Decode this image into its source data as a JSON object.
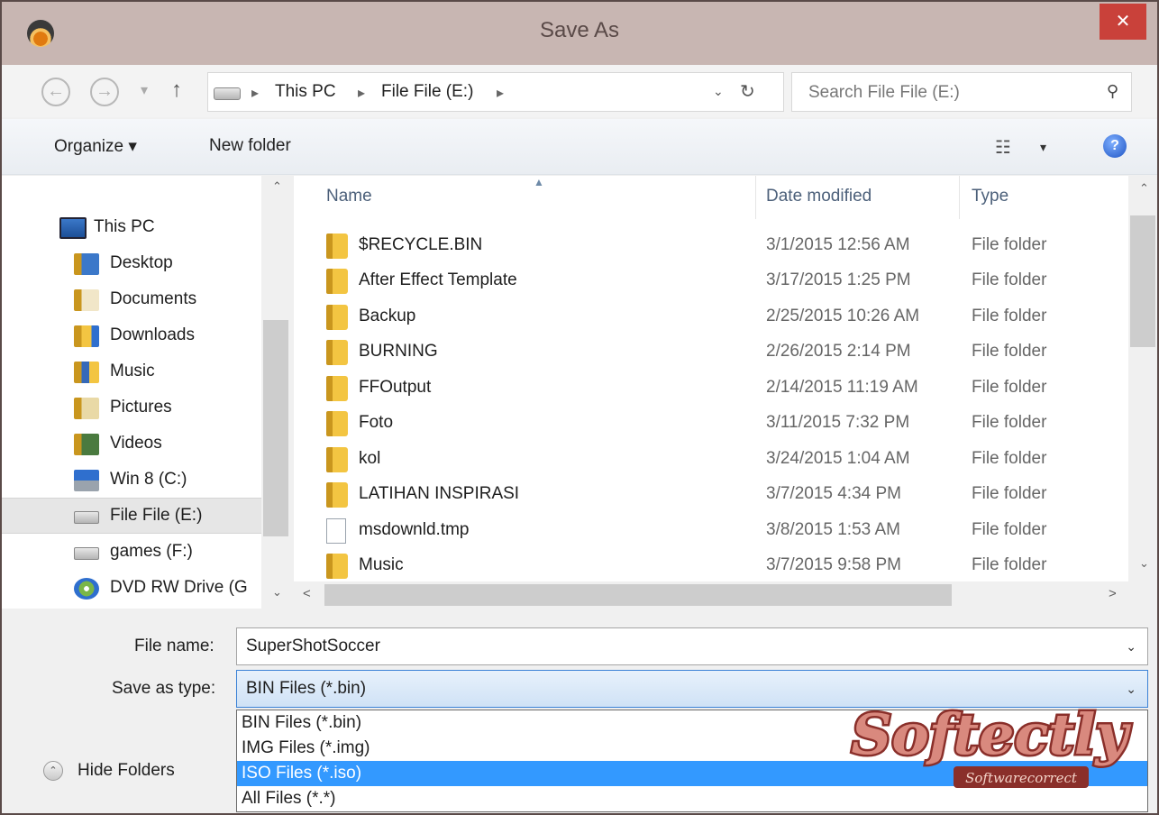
{
  "window": {
    "title": "Save As",
    "close_glyph": "✕"
  },
  "colors": {
    "title_bar": "#c8b6b2",
    "close_button": "#c9413a",
    "selection": "#3399ff",
    "folder": "#f3c542"
  },
  "icons": {
    "app": "media-app-icon",
    "back": "back-arrow-icon",
    "forward": "forward-arrow-icon",
    "recent": "chevron-down-icon",
    "up": "up-arrow-icon",
    "drive": "drive-icon",
    "refresh": "refresh-icon",
    "search": "search-icon",
    "view": "view-options-icon",
    "help": "help-icon",
    "folder": "folder-icon",
    "file": "file-icon"
  },
  "nav_buttons": {
    "back": "←",
    "forward": "→",
    "recent": "▾",
    "up": "↑"
  },
  "address": {
    "sep": "▸",
    "crumbs": [
      "This PC",
      "File File (E:)"
    ],
    "dropdown_glyph": "⌄",
    "refresh_glyph": "↻"
  },
  "search": {
    "placeholder": "Search File File (E:)",
    "glyph": "⚲"
  },
  "toolbar": {
    "organize": "Organize ▾",
    "new_folder": "New folder",
    "view_glyph": "☷",
    "view_caret": "▾",
    "help_glyph": "?"
  },
  "nav_pane": {
    "items": [
      {
        "label": "This PC",
        "icon": "computer-icon"
      },
      {
        "label": "Desktop",
        "icon": "desktop-icon"
      },
      {
        "label": "Documents",
        "icon": "documents-icon"
      },
      {
        "label": "Downloads",
        "icon": "downloads-icon"
      },
      {
        "label": "Music",
        "icon": "music-icon"
      },
      {
        "label": "Pictures",
        "icon": "pictures-icon"
      },
      {
        "label": "Videos",
        "icon": "videos-icon"
      },
      {
        "label": "Win 8 (C:)",
        "icon": "system-drive-icon"
      },
      {
        "label": "File File (E:)",
        "icon": "drive-icon",
        "selected": true
      },
      {
        "label": "games (F:)",
        "icon": "drive-icon"
      },
      {
        "label": "DVD RW Drive (G",
        "icon": "dvd-drive-icon"
      }
    ]
  },
  "scroll_glyphs": {
    "up": "⌃",
    "down": "⌄",
    "left": "<",
    "right": ">"
  },
  "file_list": {
    "columns": {
      "name": "Name",
      "date": "Date modified",
      "type": "Type"
    },
    "sort_glyph": "▲",
    "rows": [
      {
        "name": "$RECYCLE.BIN",
        "date": "3/1/2015 12:56 AM",
        "type": "File folder",
        "kind": "folder"
      },
      {
        "name": "After Effect Template",
        "date": "3/17/2015 1:25 PM",
        "type": "File folder",
        "kind": "folder"
      },
      {
        "name": "Backup",
        "date": "2/25/2015 10:26 AM",
        "type": "File folder",
        "kind": "folder"
      },
      {
        "name": "BURNING",
        "date": "2/26/2015 2:14 PM",
        "type": "File folder",
        "kind": "folder"
      },
      {
        "name": "FFOutput",
        "date": "2/14/2015 11:19 AM",
        "type": "File folder",
        "kind": "folder"
      },
      {
        "name": "Foto",
        "date": "3/11/2015 7:32 PM",
        "type": "File folder",
        "kind": "folder"
      },
      {
        "name": "kol",
        "date": "3/24/2015 1:04 AM",
        "type": "File folder",
        "kind": "folder"
      },
      {
        "name": "LATIHAN INSPIRASI",
        "date": "3/7/2015 4:34 PM",
        "type": "File folder",
        "kind": "folder"
      },
      {
        "name": "msdownld.tmp",
        "date": "3/8/2015 1:53 AM",
        "type": "File folder",
        "kind": "file"
      },
      {
        "name": "Music",
        "date": "3/7/2015 9:58 PM",
        "type": "File folder",
        "kind": "folder"
      }
    ]
  },
  "form": {
    "file_name_label": "File name:",
    "file_name_value": "SuperShotSoccer",
    "save_type_label": "Save as type:",
    "save_type_value": "BIN Files (*.bin)",
    "caret": "⌄",
    "type_options": [
      {
        "label": "BIN Files (*.bin)"
      },
      {
        "label": "IMG Files (*.img)"
      },
      {
        "label": "ISO Files (*.iso)",
        "highlighted": true
      },
      {
        "label": "All Files (*.*)"
      }
    ]
  },
  "hide_folders": {
    "label": "Hide Folders",
    "glyph": "⌃"
  },
  "watermark": {
    "brand": "Softectly",
    "tagline": "Softwarecorrect"
  }
}
